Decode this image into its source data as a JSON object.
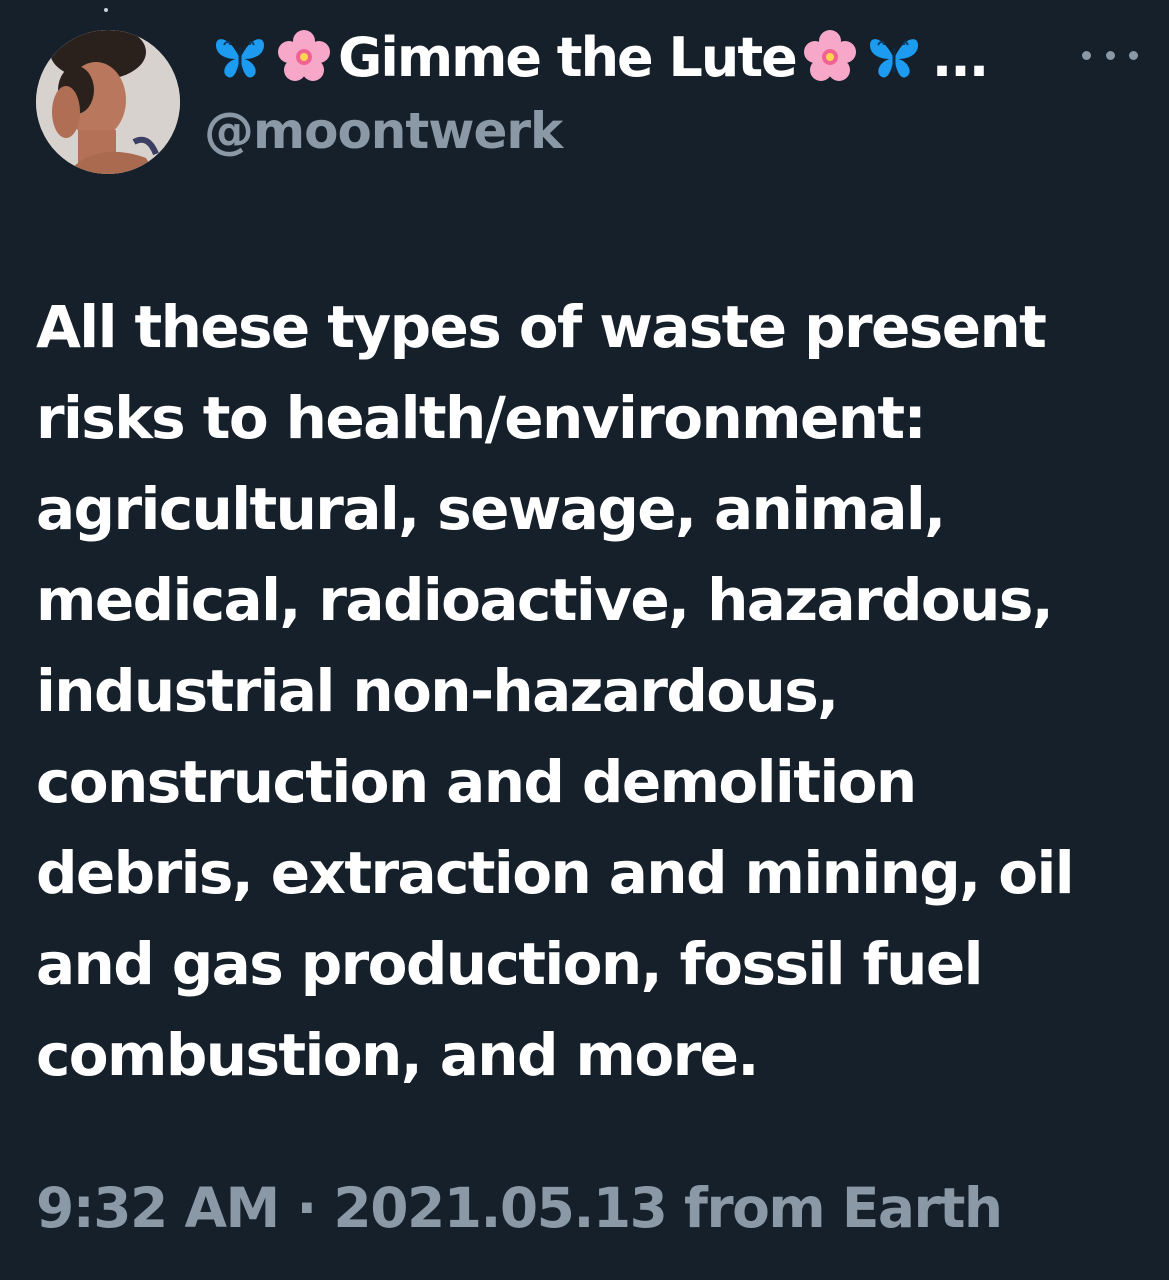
{
  "tweet": {
    "display_name": "Gimme the Lute",
    "name_truncation": "...",
    "handle": "@moontwerk",
    "body_lines": [
      "All these types of waste present",
      "risks to health/environment:",
      "agricultural, sewage, animal,",
      "medical, radioactive, hazardous,",
      "industrial non-hazardous,",
      "construction and demolition",
      "debris, extraction and mining, oil",
      "and gas production, fossil fuel",
      "combustion, and more."
    ],
    "timestamp": "9:32 AM · 2021.05.13 from Earth"
  },
  "icons": {
    "name_emojis_left": [
      "butterfly-icon",
      "cherry-blossom-icon"
    ],
    "name_emojis_right": [
      "cherry-blossom-icon",
      "butterfly-icon"
    ],
    "more": "more-options-icon"
  },
  "colors": {
    "background": "#15202b",
    "primary_text": "#ffffff",
    "secondary_text": "#8b98a5",
    "butterfly": "#1da1f2",
    "blossom": "#f7a3c4"
  }
}
